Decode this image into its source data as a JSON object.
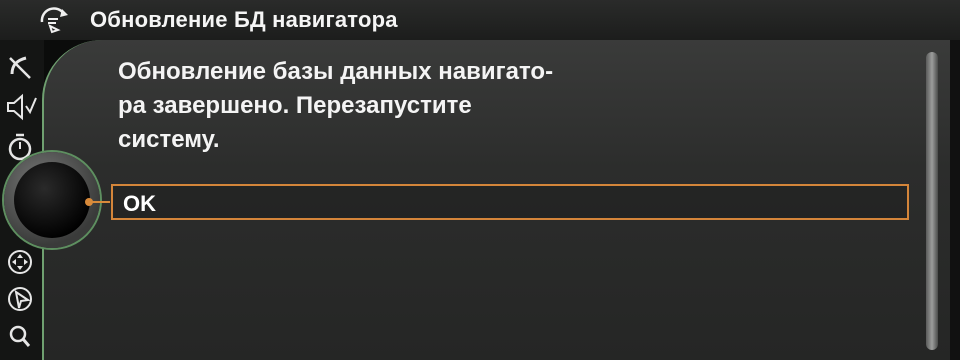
{
  "header": {
    "title": "Обновление БД навигатора",
    "icon": "navigation-update-icon"
  },
  "sidebar": {
    "items": [
      {
        "icon": "phone-mute-icon"
      },
      {
        "icon": "speaker-icon"
      },
      {
        "icon": "stopwatch-icon"
      },
      {
        "icon": "controller-knob"
      },
      {
        "icon": "directional-pad-icon"
      },
      {
        "icon": "navigation-arrow-icon"
      },
      {
        "icon": "search-icon"
      }
    ]
  },
  "dialog": {
    "message_lines": [
      "Обновление базы данных навигато-",
      "ра завершено. Перезапустите",
      "систему."
    ],
    "ok_label": "OK"
  },
  "colors": {
    "accent": "#d4853a",
    "frame_green": "#6fa070",
    "panel_bg": "#2c2d2c"
  }
}
